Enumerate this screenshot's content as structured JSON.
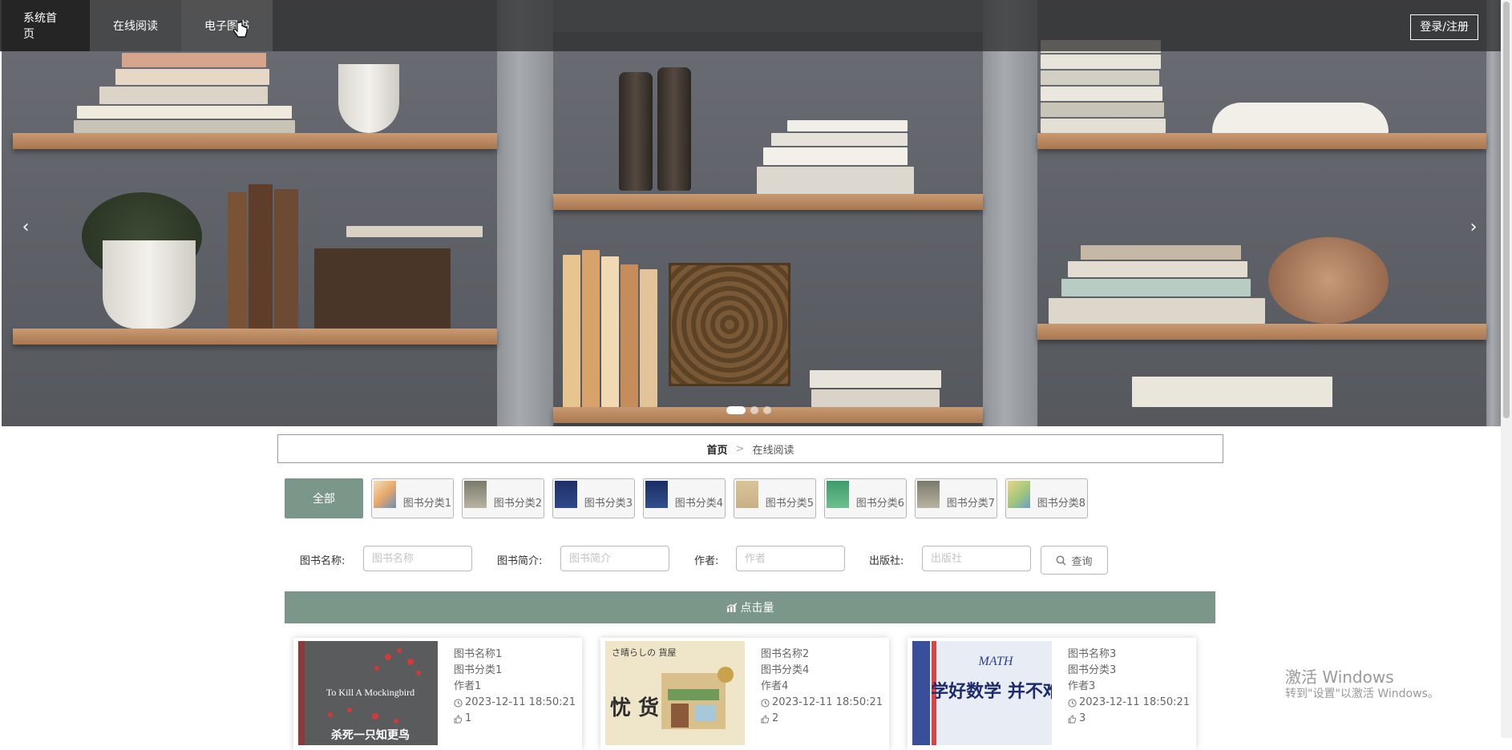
{
  "nav": {
    "items": [
      {
        "label": "系统首页"
      },
      {
        "label": "在线阅读"
      },
      {
        "label": "电子图书"
      }
    ],
    "login_label": "登录/注册"
  },
  "carousel": {
    "prev_icon": "‹",
    "next_icon": "›",
    "slide_count": 3,
    "active_index": 0
  },
  "breadcrumb": {
    "home": "首页",
    "separator": ">",
    "current": "在线阅读"
  },
  "categories": {
    "all_label": "全部",
    "items": [
      "图书分类1",
      "图书分类2",
      "图书分类3",
      "图书分类4",
      "图书分类5",
      "图书分类6",
      "图书分类7",
      "图书分类8"
    ]
  },
  "search": {
    "name_label": "图书名称:",
    "name_placeholder": "图书名称",
    "intro_label": "图书简介:",
    "intro_placeholder": "图书简介",
    "author_label": "作者:",
    "author_placeholder": "作者",
    "publisher_label": "出版社:",
    "publisher_placeholder": "出版社",
    "button_label": "查询"
  },
  "section": {
    "title": "点击量"
  },
  "books": [
    {
      "name": "图书名称1",
      "category": "图书分类1",
      "author": "作者1",
      "time": "2023-12-11 18:50:21",
      "likes": "1",
      "cover_title": "To Kill A Mockingbird",
      "cover_sub": "杀死一只知更鸟"
    },
    {
      "name": "图书名称2",
      "category": "图书分类4",
      "author": "作者4",
      "time": "2023-12-11 18:50:21",
      "likes": "2",
      "cover_title": "忧 货",
      "cover_sub": "さ晴らしの 貨屋"
    },
    {
      "name": "图书名称3",
      "category": "图书分类3",
      "author": "作者3",
      "time": "2023-12-11 18:50:21",
      "likes": "3",
      "cover_title": "学好数学 并不难",
      "cover_sub": "MATH"
    }
  ],
  "watermark": {
    "line1": "激活 Windows",
    "line2": "转到\"设置\"以激活 Windows。"
  },
  "colors": {
    "accent": "#7b978a",
    "nav_bg": "#282828"
  }
}
